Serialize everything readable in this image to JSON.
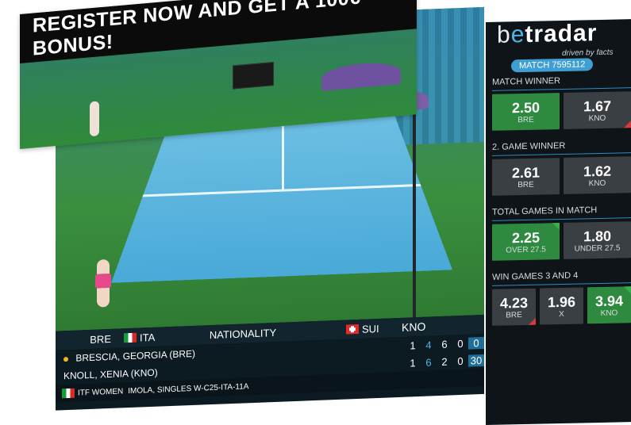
{
  "banner": {
    "text": "REGISTER NOW AND GET A 100€ BONUS!"
  },
  "scoreboard": {
    "header": {
      "left_code": "BRE",
      "left_country": "ITA",
      "middle": "NATIONALITY",
      "right_country": "SUI",
      "right_code": "KNO"
    },
    "players": [
      {
        "name": "BRESCIA, GEORGIA",
        "code": "(BRE)",
        "serving": true,
        "sets": "1",
        "g1": "4",
        "g2": "6",
        "g3": "0",
        "points": "0"
      },
      {
        "name": "KNOLL, XENIA",
        "code": "(KNO)",
        "serving": false,
        "sets": "1",
        "g1": "6",
        "g2": "2",
        "g3": "0",
        "points": "30"
      }
    ],
    "footer": {
      "competition": "ITF WOMEN",
      "event": "IMOLA, SINGLES W-C25-ITA-11A"
    }
  },
  "sidebar": {
    "logo": {
      "part1": "b",
      "part2": "e",
      "part3": "t",
      "part4": "radar"
    },
    "tagline": "driven by facts",
    "match_label": "MATCH 7595112",
    "markets": [
      {
        "title": "MATCH WINNER",
        "odds": [
          {
            "value": "2.50",
            "label": "BRE"
          },
          {
            "value": "1.67",
            "label": "KNO"
          }
        ]
      },
      {
        "title": "2. GAME WINNER",
        "odds": [
          {
            "value": "2.61",
            "label": "BRE"
          },
          {
            "value": "1.62",
            "label": "KNO"
          }
        ]
      },
      {
        "title": "TOTAL GAMES IN MATCH",
        "odds": [
          {
            "value": "2.25",
            "label": "OVER 27.5"
          },
          {
            "value": "1.80",
            "label": "UNDER 27.5"
          }
        ]
      },
      {
        "title": "WIN GAMES 3 AND 4",
        "odds": [
          {
            "value": "4.23",
            "label": "BRE"
          },
          {
            "value": "1.96",
            "label": "X"
          },
          {
            "value": "3.94",
            "label": "KNO"
          }
        ]
      }
    ]
  },
  "colors": {
    "accent": "#3f9fd3",
    "green": "#2e8a3f",
    "dark": "#0f1418",
    "up": "#34b24a",
    "down": "#d63a3a"
  }
}
